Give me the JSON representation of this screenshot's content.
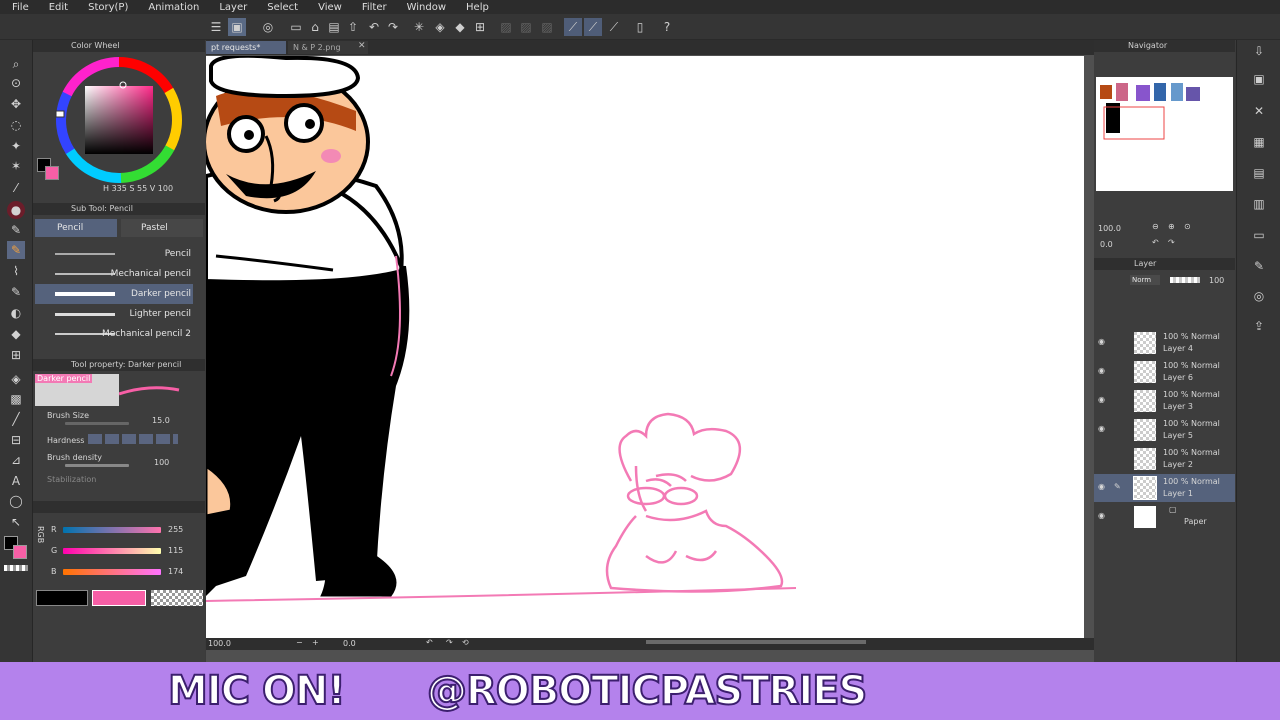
{
  "menu": [
    "File",
    "Edit",
    "Story(P)",
    "Animation",
    "Layer",
    "Select",
    "View",
    "Filter",
    "Window",
    "Help"
  ],
  "tabs": {
    "active": "pt requests*",
    "second": "N & P 2.png"
  },
  "color_wheel": {
    "title": "Color Wheel",
    "h": "335",
    "s": "55",
    "v": "100",
    "h_label": "H",
    "s_label": "S",
    "v_label": "V"
  },
  "subtool": {
    "title": "Sub Tool: Pencil",
    "tab_pencil": "Pencil",
    "tab_pastel": "Pastel",
    "items": [
      "Pencil",
      "Mechanical pencil",
      "Darker pencil",
      "Lighter pencil",
      "Mechanical pencil 2"
    ],
    "selected_index": 2
  },
  "tool_property": {
    "title": "Tool property: Darker pencil",
    "preview_label": "Darker pencil",
    "brush_size_label": "Brush Size",
    "brush_size": "15.0",
    "hardness_label": "Hardness",
    "brush_density_label": "Brush density",
    "brush_density": "100",
    "stabilization_label": "Stabilization"
  },
  "rgb": {
    "r_label": "R",
    "g_label": "G",
    "b_label": "B",
    "r": "255",
    "g": "115",
    "b": "174",
    "side": "RGB"
  },
  "colors": {
    "main": "#000000",
    "sub": "#f75fa6",
    "accent": "#f37ab5",
    "banner": "#b482ec",
    "canvas_bg": "#ffffff"
  },
  "canvas_status": {
    "zoom": "100.0",
    "rotation": "0.0"
  },
  "navigator": {
    "title": "Navigator",
    "zoom": "100.0",
    "angle": "0.0"
  },
  "layer_panel": {
    "title": "Layer",
    "blend": "Norm",
    "opacity": "100",
    "layers": [
      {
        "mode": "100 % Normal",
        "name": "Layer 4"
      },
      {
        "mode": "100 % Normal",
        "name": "Layer 6"
      },
      {
        "mode": "100 % Normal",
        "name": "Layer 3"
      },
      {
        "mode": "100 % Normal",
        "name": "Layer 5"
      },
      {
        "mode": "100 % Normal",
        "name": "Layer 2"
      },
      {
        "mode": "100 % Normal",
        "name": "Layer 1"
      }
    ],
    "paper": "Paper",
    "selected_index": 5
  },
  "banner": {
    "left": "MIC ON!",
    "right": "@ROBOTICPASTRIES"
  }
}
